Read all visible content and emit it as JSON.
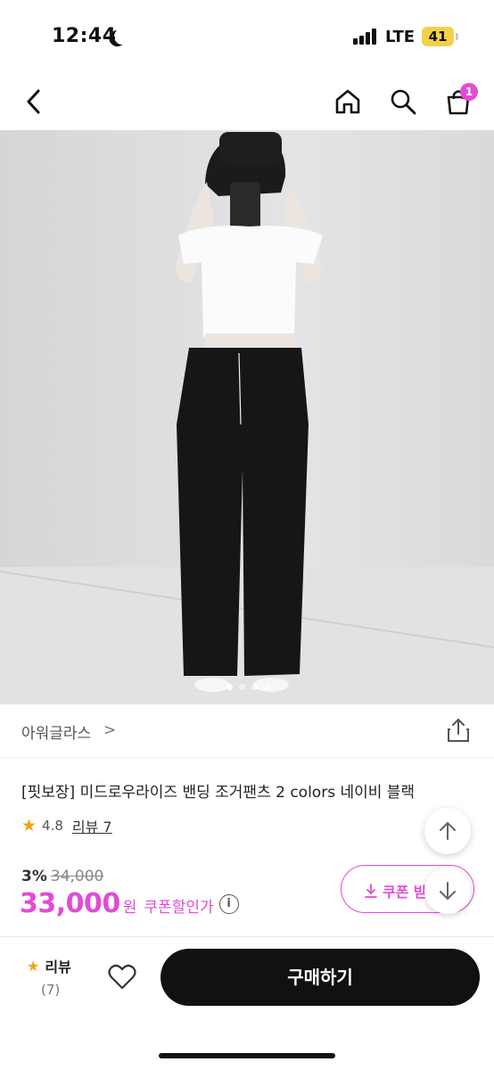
{
  "status_bar": {
    "time": "12:44",
    "network": "LTE",
    "battery": "41"
  },
  "nav": {
    "cart_count": "1"
  },
  "gallery": {
    "total": 4,
    "active": 1
  },
  "brand": {
    "name": "아워글라스",
    "chevron": ">"
  },
  "product": {
    "title": "[핏보장] 미드로우라이즈 밴딩 조거팬츠 2 colors 네이비 블랙",
    "rating": "4.8",
    "review_link": "리뷰 7"
  },
  "pricing": {
    "discount_rate": "3%",
    "original_price": "34,000",
    "price": "33,000",
    "currency": "원",
    "coupon_note": "쿠폰할인가",
    "info_icon": "i"
  },
  "coupon_button": {
    "label": "쿠폰 받"
  },
  "bottom_bar": {
    "review_label": "리뷰",
    "review_count": "(7)",
    "buy_label": "구매하기"
  },
  "colors": {
    "accent": "#e34bd6",
    "star": "#f4a01a",
    "buy": "#111111"
  },
  "icons": [
    "moon-icon",
    "signal-icon",
    "back-icon",
    "home-icon",
    "search-icon",
    "cart-icon",
    "share-icon",
    "star-icon",
    "info-icon",
    "download-icon",
    "arrow-up-icon",
    "arrow-down-icon",
    "heart-icon"
  ]
}
